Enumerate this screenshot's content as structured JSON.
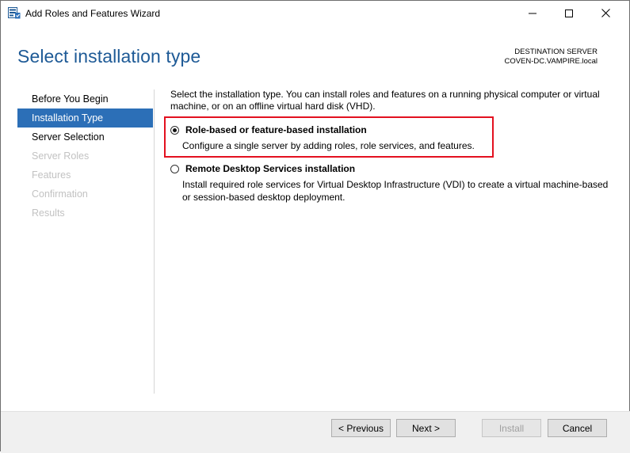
{
  "window": {
    "title": "Add Roles and Features Wizard"
  },
  "header": {
    "title": "Select installation type",
    "destination_label": "DESTINATION SERVER",
    "destination_server": "COVEN-DC.VAMPIRE.local"
  },
  "nav": {
    "items": [
      {
        "label": "Before You Begin",
        "state": "normal"
      },
      {
        "label": "Installation Type",
        "state": "active"
      },
      {
        "label": "Server Selection",
        "state": "normal"
      },
      {
        "label": "Server Roles",
        "state": "disabled"
      },
      {
        "label": "Features",
        "state": "disabled"
      },
      {
        "label": "Confirmation",
        "state": "disabled"
      },
      {
        "label": "Results",
        "state": "disabled"
      }
    ]
  },
  "main": {
    "intro": "Select the installation type. You can install roles and features on a running physical computer or virtual machine, or on an offline virtual hard disk (VHD).",
    "options": [
      {
        "title": "Role-based or feature-based installation",
        "description": "Configure a single server by adding roles, role services, and features.",
        "selected": true
      },
      {
        "title": "Remote Desktop Services installation",
        "description": "Install required role services for Virtual Desktop Infrastructure (VDI) to create a virtual machine-based or session-based desktop deployment.",
        "selected": false
      }
    ]
  },
  "footer": {
    "previous_label": "< Previous",
    "next_label": "Next >",
    "install_label": "Install",
    "cancel_label": "Cancel"
  },
  "colors": {
    "accent": "#2c6fb7",
    "title_blue": "#1e5a96",
    "highlight_red": "#e3101f"
  }
}
